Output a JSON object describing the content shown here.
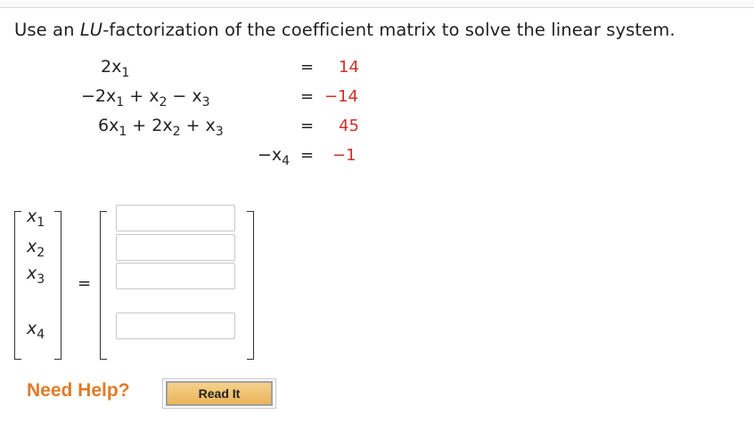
{
  "prompt": {
    "before": "Use an ",
    "italic": "LU",
    "after": "-factorization of the coefficient matrix to solve the linear system."
  },
  "equations": [
    {
      "lhs_parts": [
        "2x",
        "1"
      ],
      "rhs": "14"
    },
    {
      "lhs_parts": [
        "−2x",
        "1",
        " + ",
        "x",
        "2",
        " − ",
        "x",
        "3"
      ],
      "rhs": "−14"
    },
    {
      "lhs_parts": [
        "6x",
        "1",
        " + ",
        "2x",
        "2",
        " + ",
        "x",
        "3"
      ],
      "rhs": "45"
    },
    {
      "lhs_parts": [
        "−x",
        "4"
      ],
      "rhs": "−1"
    }
  ],
  "equals": "=",
  "vector_vars": [
    {
      "name": "x",
      "sub": "1"
    },
    {
      "name": "x",
      "sub": "2"
    },
    {
      "name": "x",
      "sub": "3"
    },
    {
      "name": "x",
      "sub": "4"
    }
  ],
  "answers": [
    "",
    "",
    "",
    ""
  ],
  "help": {
    "label": "Need Help?",
    "button": "Read It"
  },
  "colors": {
    "rhs_red": "#d0302a",
    "help_orange": "#e07b27"
  }
}
